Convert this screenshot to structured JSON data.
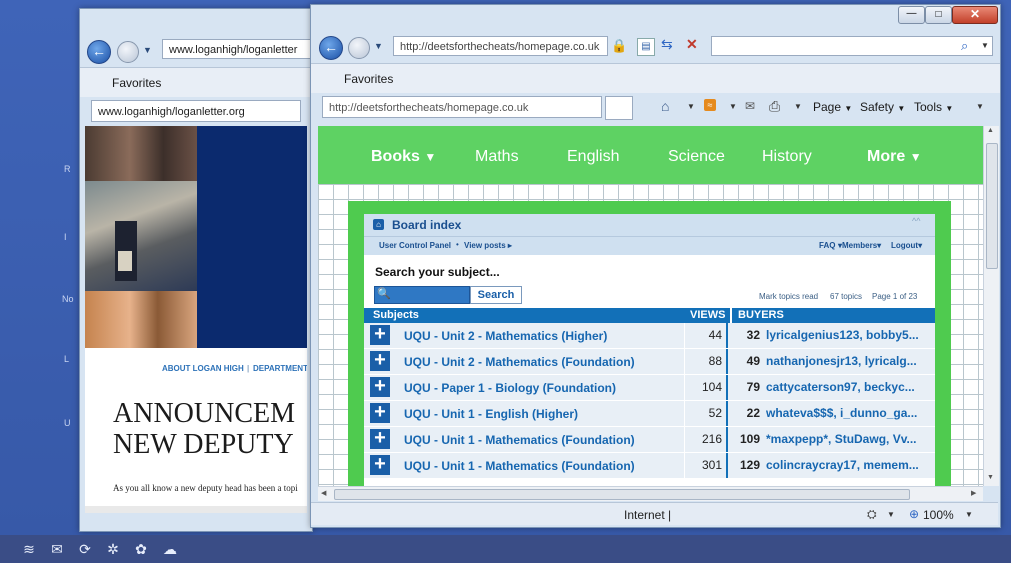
{
  "desktop": {
    "taskbar_icons": [
      "wifi-icon",
      "mail-icon",
      "sync-icon",
      "settings-icon",
      "paw-icon",
      "cloud-icon"
    ]
  },
  "window1": {
    "address": "www.loganhigh/loganletter",
    "address_bar2": "www.loganhigh/loganletter.org",
    "favorites_label": "Favorites",
    "nav_links": [
      "ABOUT LOGAN HIGH",
      "DEPARTMENT"
    ],
    "headline_line1": "ANNOUNCEM",
    "headline_line2": "NEW DEPUTY",
    "body_text": "As you all know a new deputy head has been a topi"
  },
  "window2": {
    "address": "http://deetsforthecheats/homepage.co.uk",
    "address_bar2": "http://deetsforthecheats/homepage.co.uk",
    "favorites_label": "Favorites",
    "toolbar": {
      "page": "Page",
      "safety": "Safety",
      "tools": "Tools"
    },
    "nav": {
      "books": "Books",
      "maths": "Maths",
      "english": "English",
      "science": "Science",
      "history": "History",
      "more": "More"
    },
    "forum": {
      "board_index": "Board index",
      "user_control_panel": "User Control Panel",
      "view_posts": "View posts",
      "faq": "FAQ",
      "members": "Members",
      "logout": "Logout",
      "search_prompt": "Search your subject...",
      "search_button": "Search",
      "mark_topics": "Mark topics read",
      "topics_count": "67 topics",
      "page_info": "Page 1 of 23",
      "headers": {
        "subjects": "Subjects",
        "views": "VIEWS",
        "buyers": "BUYERS"
      },
      "rows": [
        {
          "subject": "UQU - Unit 2 - Mathematics (Higher)",
          "views": "44",
          "buyer_count": "32",
          "buyers": "lyricalgenius123, bobby5..."
        },
        {
          "subject": "UQU - Unit 2 - Mathematics (Foundation)",
          "views": "88",
          "buyer_count": "49",
          "buyers": "nathanjonesjr13, lyricalg..."
        },
        {
          "subject": "UQU - Paper 1 - Biology (Foundation)",
          "views": "104",
          "buyer_count": "79",
          "buyers": "cattycaterson97, beckyc..."
        },
        {
          "subject": "UQU - Unit 1 - English (Higher)",
          "views": "52",
          "buyer_count": "22",
          "buyers": "whateva$$$, i_dunno_ga..."
        },
        {
          "subject": "UQU - Unit 1 - Mathematics (Foundation)",
          "views": "216",
          "buyer_count": "109",
          "buyers": "*maxpepp*, StuDawg, Vv..."
        },
        {
          "subject": "UQU - Unit 1 - Mathematics (Foundation)",
          "views": "301",
          "buyer_count": "129",
          "buyers": "colincraycray17, memem..."
        }
      ]
    },
    "status": {
      "zone": "Internet |",
      "zoom": "100%"
    }
  }
}
